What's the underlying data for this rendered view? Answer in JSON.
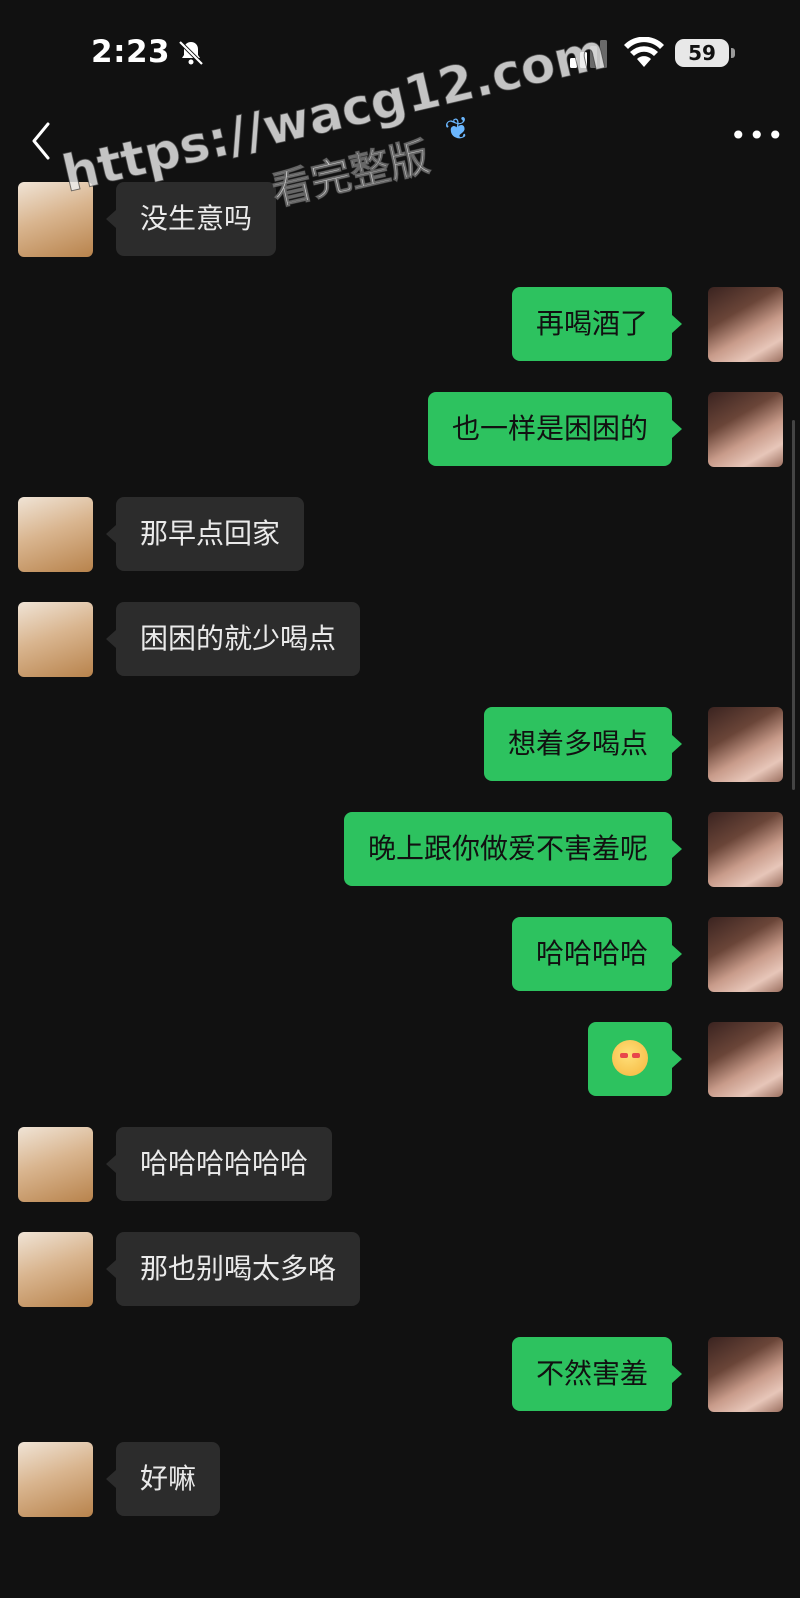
{
  "status": {
    "time": "2:23",
    "battery": "59"
  },
  "watermark": {
    "url": "https://wacg12.com",
    "subtitle": "看完整版"
  },
  "messages": [
    {
      "side": "left",
      "text": "没生意吗"
    },
    {
      "side": "right",
      "text": "再喝酒了"
    },
    {
      "side": "right",
      "text": "也一样是困困的"
    },
    {
      "side": "left",
      "text": "那早点回家"
    },
    {
      "side": "left",
      "text": "困困的就少喝点"
    },
    {
      "side": "right",
      "text": "想着多喝点"
    },
    {
      "side": "right",
      "text": "晚上跟你做爱不害羞呢"
    },
    {
      "side": "right",
      "text": "哈哈哈哈"
    },
    {
      "side": "right",
      "text": "",
      "emoji": "blushing-face"
    },
    {
      "side": "left",
      "text": "哈哈哈哈哈哈"
    },
    {
      "side": "left",
      "text": "那也别喝太多咯"
    },
    {
      "side": "right",
      "text": "不然害羞"
    },
    {
      "side": "left",
      "text": "好嘛"
    }
  ]
}
